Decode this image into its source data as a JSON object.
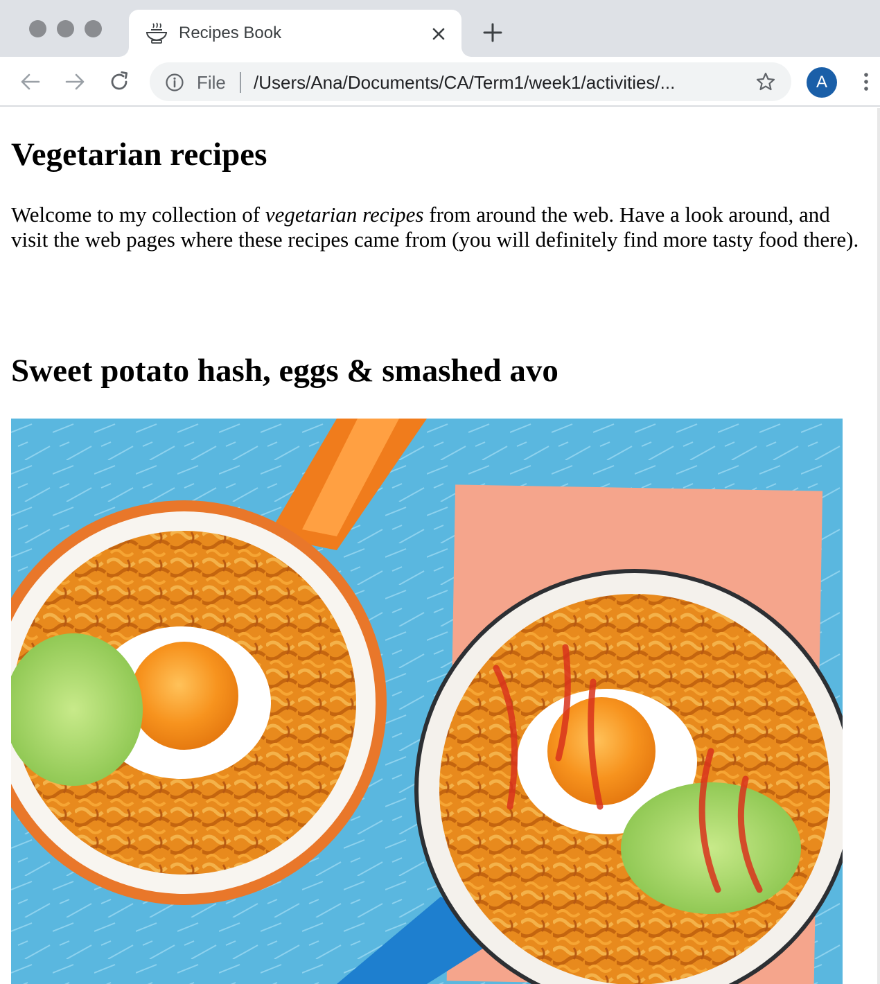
{
  "browser": {
    "tab": {
      "title": "Recipes Book",
      "favicon": "bowl-icon"
    },
    "address_bar": {
      "scheme_label": "File",
      "url": "/Users/Ana/Documents/CA/Term1/week1/activities/..."
    },
    "profile_initial": "A",
    "colors": {
      "tabstrip": "#dee1e6",
      "omnibox": "#f1f3f4",
      "avatar": "#1a5fa8"
    }
  },
  "page": {
    "heading": "Vegetarian recipes",
    "intro": {
      "before": "Welcome to my collection of ",
      "emphasis": "vegetarian recipes",
      "after": " from around the web. Have a look around, and visit the web pages where these recipes came from (you will definitely find more tasty food there)."
    },
    "recipes": [
      {
        "title": "Sweet potato hash, eggs & smashed avo",
        "image": "photo of two pans of spiralized sweet potato hash with fried eggs and smashed avocado"
      }
    ]
  }
}
